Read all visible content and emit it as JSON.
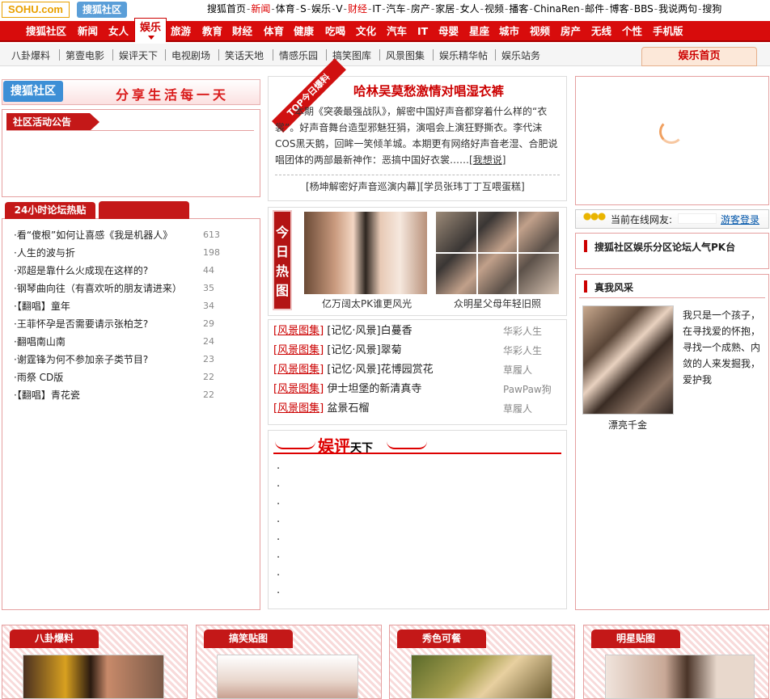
{
  "header": {
    "logo": "SOHU.com",
    "logo2": "搜狐社区",
    "topnav": [
      {
        "label": "搜狐首页",
        "red": false
      },
      {
        "label": "新闻",
        "red": true
      },
      {
        "label": "体育",
        "red": false
      },
      {
        "label": "S",
        "red": false
      },
      {
        "label": "娱乐",
        "red": false
      },
      {
        "label": "V",
        "red": false
      },
      {
        "label": "财经",
        "red": true
      },
      {
        "label": "IT",
        "red": false
      },
      {
        "label": "汽车",
        "red": false
      },
      {
        "label": "房产",
        "red": false
      },
      {
        "label": "家居",
        "red": false
      },
      {
        "label": "女人",
        "red": false
      },
      {
        "label": "视频",
        "red": false
      },
      {
        "label": "播客",
        "red": false
      },
      {
        "label": "ChinaRen",
        "red": false
      },
      {
        "label": "邮件",
        "red": false
      },
      {
        "label": "博客",
        "red": false
      },
      {
        "label": "BBS",
        "red": false
      },
      {
        "label": "我说两句",
        "red": false
      },
      {
        "label": "搜狗",
        "red": false
      }
    ]
  },
  "mainnav": [
    "搜狐社区",
    "新闻",
    "女人",
    "娱乐",
    "旅游",
    "教育",
    "财经",
    "体育",
    "健康",
    "吃喝",
    "文化",
    "汽车",
    "IT",
    "母婴",
    "星座",
    "城市",
    "视频",
    "房产",
    "无线",
    "个性",
    "手机版"
  ],
  "mainnav_active": "娱乐",
  "subnav": [
    "八卦爆料",
    "第壹电影",
    "娱评天下",
    "电视剧场",
    "笑话天地",
    "情感乐园",
    "搞笑图库",
    "风景图集",
    "娱乐精华帖",
    "娱乐站务"
  ],
  "home_button": "娱乐首页",
  "left": {
    "banner_logo": "搜狐社区",
    "slogan": "分享生活每一天",
    "notice_title": "社区活动公告",
    "hot_title": "24小时论坛热贴",
    "hot_items": [
      {
        "title": "·看“傻根”如何让喜感《我是机器人》",
        "count": "613"
      },
      {
        "title": "·人生的波与折",
        "count": "198"
      },
      {
        "title": "·邓超是靠什么火成现在这样的?",
        "count": "44"
      },
      {
        "title": "·钢琴曲向往（有喜欢听的朋友请进来）",
        "count": "35"
      },
      {
        "title": "·【翻唱】童年",
        "count": "34"
      },
      {
        "title": "·王菲怀孕是否需要请示张柏芝?",
        "count": "29"
      },
      {
        "title": "·翻唱南山南",
        "count": "24"
      },
      {
        "title": "·谢霆锋为何不参加亲子类节目?",
        "count": "23"
      },
      {
        "title": "·雨祭 CD版",
        "count": "22"
      },
      {
        "title": "·【翻唱】青花瓷",
        "count": "22"
      }
    ]
  },
  "center": {
    "ribbon": "TOP今日爆料",
    "story_title": "哈林吴莫愁激情对唱湿衣裤",
    "story_body": "本期《突袭最强战队》，解密中国好声音都穿着什么样的“衣裳”。好声音舞台造型邪魅狂狷，演唱会上演狂野撕衣。李代沫COS黑天鹅，回眸一笑倾羊城。本期更有网络好声音老湿、合肥说唱团体的两部最新神作：恶搞中国好衣裳……",
    "story_more": "我想说",
    "story_links": "[杨坤解密好声音巡演内幕][学员张玮丁丁互喂蛋糕]",
    "today_label": "今日热图",
    "today_caps": [
      "亿万阔太PK谁更风光",
      "众明星父母年轻旧照"
    ],
    "scenes": [
      {
        "tag": "风景图集",
        "title": "[记忆·风景]白蔓香",
        "user": "华彩人生"
      },
      {
        "tag": "风景图集",
        "title": "[记忆·风景]翠菊",
        "user": "华彩人生"
      },
      {
        "tag": "风景图集",
        "title": "[记忆·风景]花博园赏花",
        "user": "草履人"
      },
      {
        "tag": "风景图集",
        "title": "伊士坦堡的新清真寺",
        "user": "PawPaw狗"
      },
      {
        "tag": "风景图集",
        "title": "盆景石榴",
        "user": "草履人"
      }
    ],
    "review_title": "娱评",
    "review_sub": "天下",
    "review_items": [
      "·",
      "·",
      "·",
      "·",
      "·",
      "·",
      "·",
      "·"
    ]
  },
  "right": {
    "online_label": "当前在线网友:",
    "guest_login": "游客登录",
    "pk_title": "搜狐社区娱乐分区论坛人气PK台",
    "star_title": "真我风采",
    "star_name": "漂亮千金",
    "star_text": "我只是一个孩子，在寻找爱的怀抱，寻找一个成熟、内敛的人来发掘我，爱护我"
  },
  "bottom": [
    "八卦爆料",
    "搞笑贴图",
    "秀色可餐",
    "明星贴图"
  ]
}
